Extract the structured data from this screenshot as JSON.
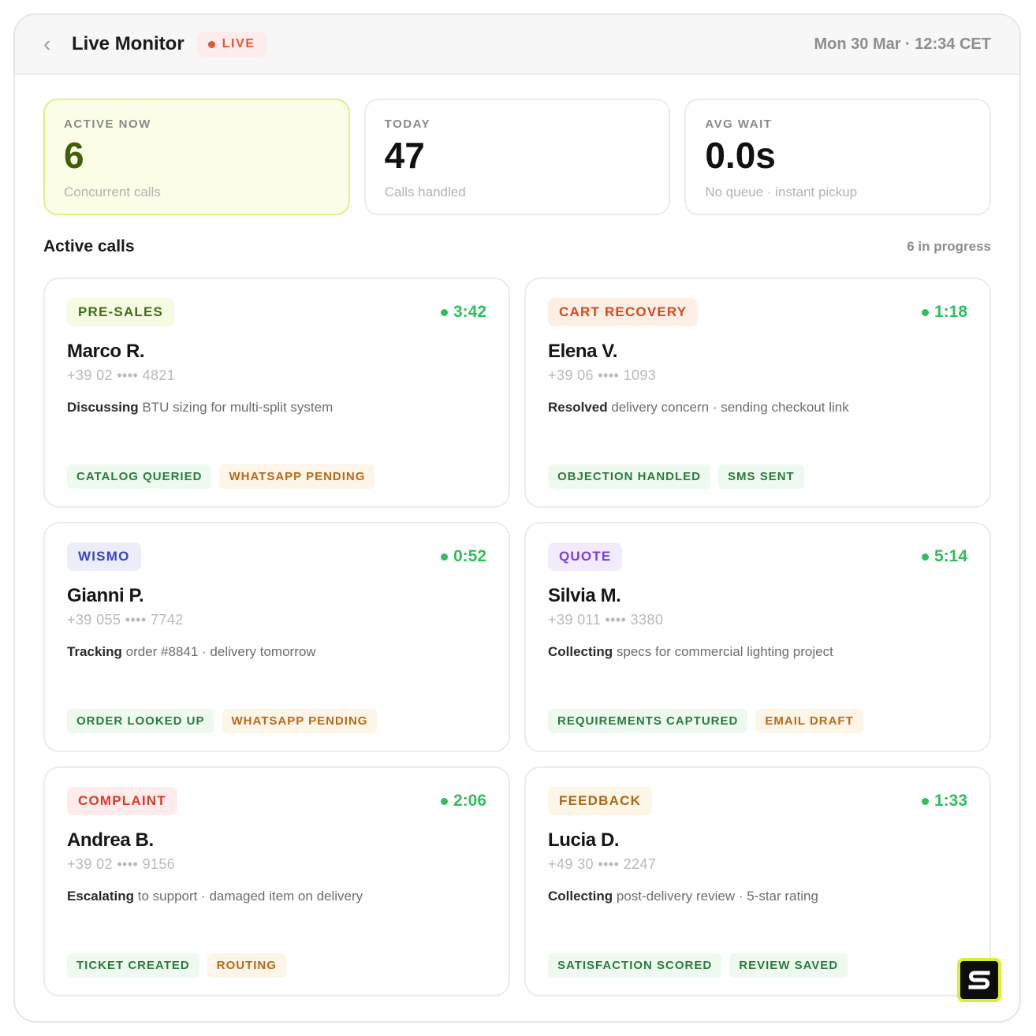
{
  "header": {
    "back_icon": "chevron-left-icon",
    "title": "Live Monitor",
    "live_label": "LIVE",
    "datetime": "Mon 30 Mar · 12:34 CET"
  },
  "stats": [
    {
      "label": "ACTIVE NOW",
      "value": "6",
      "sub": "Concurrent calls",
      "highlight": true
    },
    {
      "label": "TODAY",
      "value": "47",
      "sub": "Calls handled",
      "highlight": false
    },
    {
      "label": "AVG WAIT",
      "value": "0.0s",
      "sub": "No queue · instant pickup",
      "highlight": false
    }
  ],
  "section": {
    "title": "Active calls",
    "count": "6 in progress"
  },
  "calls": [
    {
      "category": "PRE-SALES",
      "category_bg": "#f6fbe4",
      "category_fg": "#3f6f12",
      "timer": "3:42",
      "name": "Marco R.",
      "phone": "+39 02 •••• 4821",
      "summary_bold": "Discussing",
      "summary_rest": " BTU sizing for multi-split system",
      "badges": [
        {
          "label": "CATALOG QUERIED",
          "tone": "green"
        },
        {
          "label": "WHATSAPP PENDING",
          "tone": "amber"
        }
      ]
    },
    {
      "category": "CART RECOVERY",
      "category_bg": "#fdeee6",
      "category_fg": "#d9481c",
      "timer": "1:18",
      "name": "Elena V.",
      "phone": "+39 06 •••• 1093",
      "summary_bold": "Resolved",
      "summary_rest": " delivery concern · sending checkout link",
      "badges": [
        {
          "label": "OBJECTION HANDLED",
          "tone": "green"
        },
        {
          "label": "SMS SENT",
          "tone": "green"
        }
      ]
    },
    {
      "category": "WISMO",
      "category_bg": "#ecedfb",
      "category_fg": "#3844c9",
      "timer": "0:52",
      "name": "Gianni P.",
      "phone": "+39 055 •••• 7742",
      "summary_bold": "Tracking",
      "summary_rest": " order #8841 · delivery tomorrow",
      "badges": [
        {
          "label": "ORDER LOOKED UP",
          "tone": "green"
        },
        {
          "label": "WHATSAPP PENDING",
          "tone": "amber"
        }
      ]
    },
    {
      "category": "QUOTE",
      "category_bg": "#f1ebfb",
      "category_fg": "#7d3fd6",
      "timer": "5:14",
      "name": "Silvia M.",
      "phone": "+39 011 •••• 3380",
      "summary_bold": "Collecting",
      "summary_rest": " specs for commercial lighting project",
      "badges": [
        {
          "label": "REQUIREMENTS CAPTURED",
          "tone": "green"
        },
        {
          "label": "EMAIL DRAFT",
          "tone": "amber"
        }
      ]
    },
    {
      "category": "COMPLAINT",
      "category_bg": "#fdeceb",
      "category_fg": "#d93a2b",
      "timer": "2:06",
      "name": "Andrea B.",
      "phone": "+39 02 •••• 9156",
      "summary_bold": "Escalating",
      "summary_rest": " to support · damaged item on delivery",
      "badges": [
        {
          "label": "TICKET CREATED",
          "tone": "green"
        },
        {
          "label": "ROUTING",
          "tone": "amber"
        }
      ]
    },
    {
      "category": "FEEDBACK",
      "category_bg": "#fdf5e6",
      "category_fg": "#a8671c",
      "timer": "1:33",
      "name": "Lucia D.",
      "phone": "+49 30 •••• 2247",
      "summary_bold": "Collecting",
      "summary_rest": " post-delivery review · 5-star rating",
      "badges": [
        {
          "label": "SATISFACTION SCORED",
          "tone": "green"
        },
        {
          "label": "REVIEW SAVED",
          "tone": "green"
        }
      ]
    }
  ],
  "brand": {
    "logo_icon": "s-logo-icon",
    "accent": "#d9f02a"
  }
}
